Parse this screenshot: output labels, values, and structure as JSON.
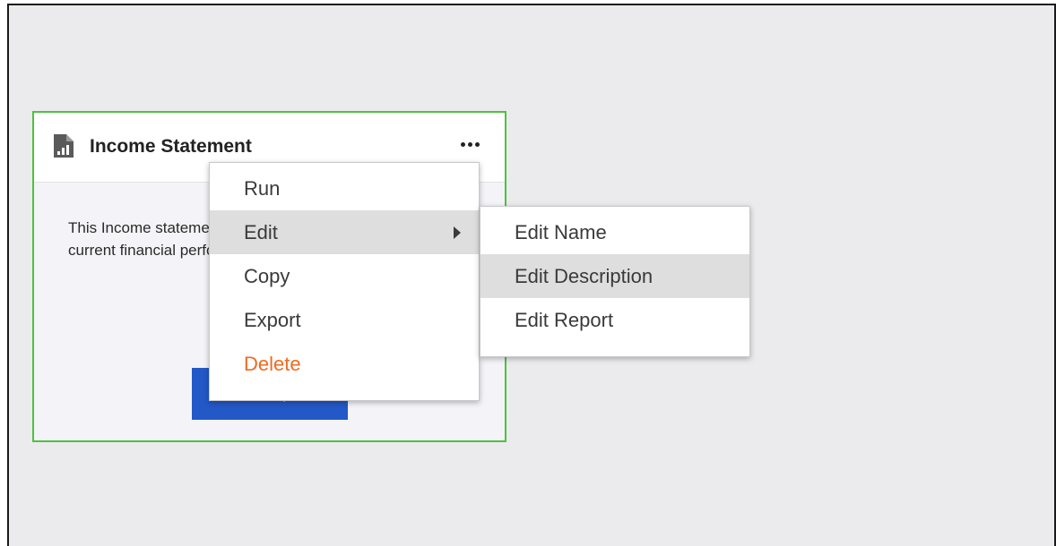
{
  "card": {
    "title": "Income Statement",
    "description_lines": [
      "This Income statement reports the company's",
      "current financial performance."
    ],
    "run_button_label": "Run Report",
    "icon": "report-file-icon",
    "more_icon": "more-horizontal-icon"
  },
  "context_menu": {
    "items": [
      {
        "label": "Run"
      },
      {
        "label": "Edit",
        "has_submenu": true,
        "highlighted": true
      },
      {
        "label": "Copy"
      },
      {
        "label": "Export"
      },
      {
        "label": "Delete",
        "color": "#ee6a23"
      }
    ]
  },
  "submenu": {
    "items": [
      {
        "label": "Edit Name"
      },
      {
        "label": "Edit Description",
        "highlighted": true
      },
      {
        "label": "Edit Report"
      }
    ]
  },
  "colors": {
    "card_border": "#4cc33e",
    "primary_button": "#2358c7",
    "delete": "#ee6a23",
    "highlight": "#dededf"
  }
}
